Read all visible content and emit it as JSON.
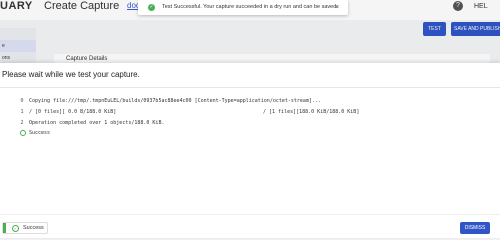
{
  "app": {
    "brand": "UARY",
    "page_title": "Create Capture",
    "docs_link": "docs",
    "help_icon": "?",
    "user_label": "HEL"
  },
  "sidebar": {
    "items": [
      {
        "label": ""
      },
      {
        "label": "e"
      },
      {
        "label": "ons"
      }
    ]
  },
  "toolbar": {
    "test_label": "TEST",
    "save_label": "SAVE AND PUBLISH"
  },
  "main": {
    "section_title": "Capture Details"
  },
  "toast": {
    "message": "Test Successful. Your capture succeeded in a dry run and can be saved.",
    "close_glyph": "×",
    "check_glyph": "✓"
  },
  "modal": {
    "title": "Please wait while we test your capture.",
    "log": [
      {
        "num": "0",
        "text": "Copying file:///tmp/.tmpnEuLEL/builds/0937b5ac88ee4c00 [Content-Type=application/octet-stream]...",
        "right": ""
      },
      {
        "num": "1",
        "text": "/ [0 files][    0.0 B/188.0 KiB]",
        "right": "/ [1 files][188.0 KiB/188.0 KiB]"
      },
      {
        "num": "2",
        "text": "Operation completed over 1 objects/188.0 KiB.",
        "right": ""
      },
      {
        "num": "",
        "text": "Success",
        "right": ""
      }
    ],
    "status_label": "Success",
    "dismiss_label": "DISMISS"
  },
  "colors": {
    "accent": "#2f55c7",
    "success": "#4caf50"
  }
}
